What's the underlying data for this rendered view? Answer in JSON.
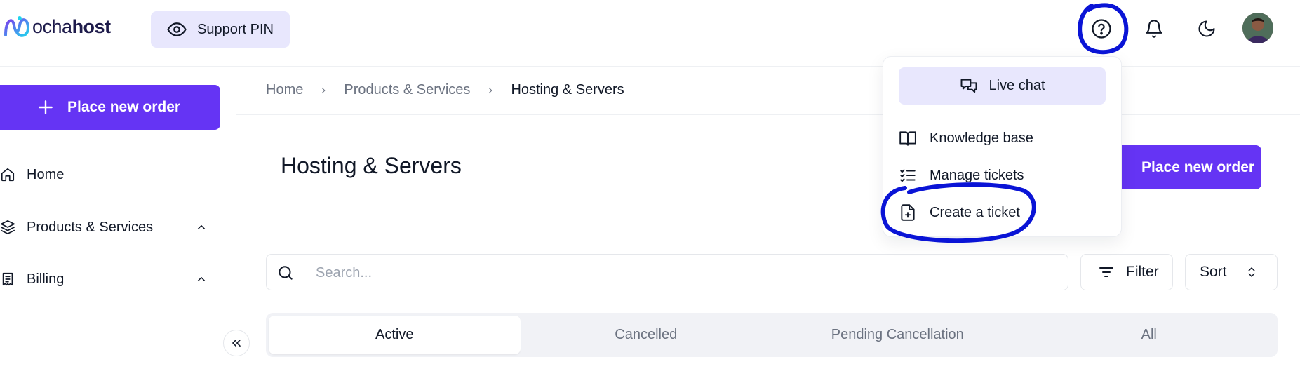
{
  "header": {
    "logo": {
      "text_regular": "ocha",
      "text_bold": "host"
    },
    "support_pin_label": "Support PIN",
    "icons": [
      "eye-icon",
      "help-circle-icon",
      "bell-icon",
      "moon-icon"
    ]
  },
  "sidebar": {
    "place_order_label": "Place new order",
    "items": [
      {
        "label": "Home",
        "icon": "home-icon"
      },
      {
        "label": "Products & Services",
        "icon": "layers-icon",
        "expandable": true
      },
      {
        "label": "Billing",
        "icon": "receipt-icon",
        "expandable": true
      }
    ]
  },
  "breadcrumb": [
    "Home",
    "Products & Services",
    "Hosting & Servers"
  ],
  "main": {
    "title": "Hosting & Servers",
    "place_order_label": "Place new order",
    "search_placeholder": "Search...",
    "filter_label": "Filter",
    "sort_label": "Sort",
    "tabs": [
      {
        "label": "Active",
        "active": true
      },
      {
        "label": "Cancelled",
        "active": false
      },
      {
        "label": "Pending Cancellation",
        "active": false
      },
      {
        "label": "All",
        "active": false
      }
    ]
  },
  "help_menu": {
    "live_chat_label": "Live chat",
    "items": [
      {
        "label": "Knowledge base",
        "icon": "book-open-icon"
      },
      {
        "label": "Manage tickets",
        "icon": "list-checks-icon"
      },
      {
        "label": "Create a ticket",
        "icon": "file-plus-icon"
      }
    ]
  },
  "colors": {
    "accent": "#6534f4",
    "accent_soft": "#e8e7fd",
    "annotation": "#0a14d6"
  }
}
